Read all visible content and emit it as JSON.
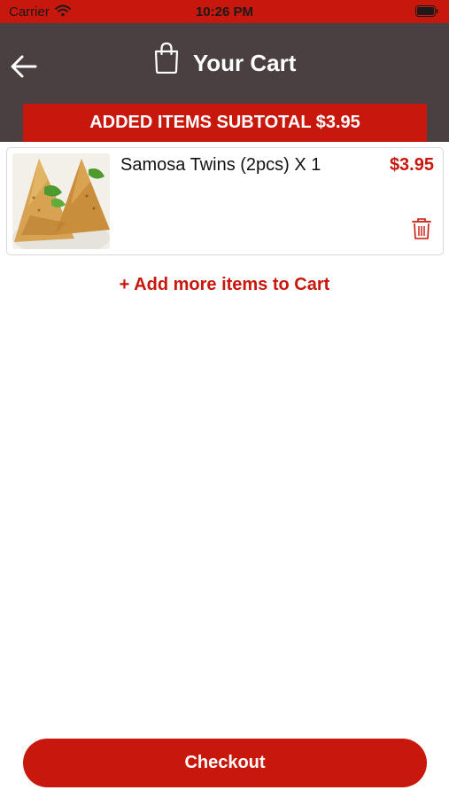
{
  "status_bar": {
    "carrier": "Carrier",
    "time": "10:26 PM",
    "wifi_icon": "wifi-icon",
    "battery_icon": "battery-icon"
  },
  "header": {
    "title": "Your Cart",
    "back_icon": "arrow-left-icon",
    "bag_icon": "shopping-bag-icon",
    "subtotal_text": "ADDED ITEMS SUBTOTAL $3.95"
  },
  "cart": {
    "items": [
      {
        "name": "Samosa Twins (2pcs) X 1",
        "price": "$3.95",
        "image": "samosa-image",
        "delete_icon": "trash-icon"
      }
    ],
    "add_more_label": "+ Add more items to Cart"
  },
  "footer": {
    "checkout_label": "Checkout"
  },
  "colors": {
    "accent": "#c8170c",
    "header_bg": "#4a3f41",
    "background": "#ffffff"
  }
}
